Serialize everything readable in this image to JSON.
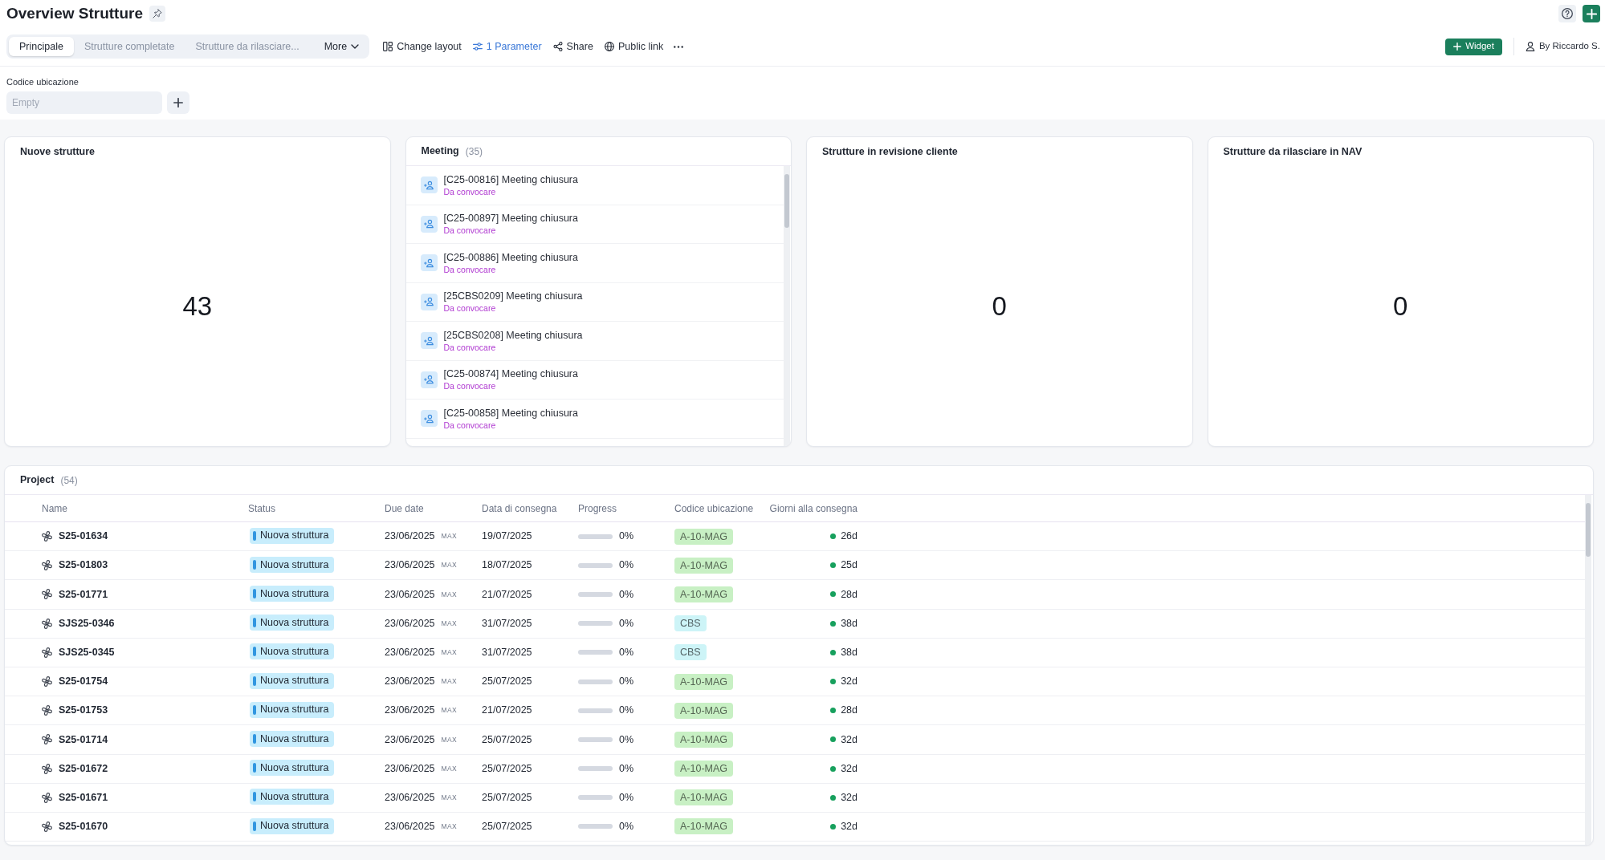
{
  "page": {
    "title": "Overview Strutture"
  },
  "tabs": [
    {
      "label": "Principale",
      "selected": true
    },
    {
      "label": "Strutture completate",
      "selected": false
    },
    {
      "label": "Strutture da rilasciare...",
      "selected": false
    }
  ],
  "more_tab": {
    "label": "More"
  },
  "toolbar": [
    {
      "kind": "layout",
      "label": "Change layout"
    },
    {
      "kind": "parameter",
      "label": "1 Parameter"
    },
    {
      "kind": "share",
      "label": "Share"
    },
    {
      "kind": "link",
      "label": "Public link"
    }
  ],
  "widget_button": {
    "label": "Widget"
  },
  "owner": {
    "label": "By Riccardo S."
  },
  "parameters": [
    {
      "label": "Codice ubicazione",
      "placeholder": "Empty"
    }
  ],
  "widgets": [
    {
      "kind": "number",
      "title": "Nuove strutture",
      "value": "43"
    },
    {
      "kind": "list",
      "title": "Meeting",
      "count": "(35)",
      "items": [
        {
          "title": "[C25-00816] Meeting chiusura",
          "status": "Da convocare"
        },
        {
          "title": "[C25-00897] Meeting chiusura",
          "status": "Da convocare"
        },
        {
          "title": "[C25-00886] Meeting chiusura",
          "status": "Da convocare"
        },
        {
          "title": "[25CBS0209] Meeting chiusura",
          "status": "Da convocare"
        },
        {
          "title": "[25CBS0208] Meeting chiusura",
          "status": "Da convocare"
        },
        {
          "title": "[C25-00874] Meeting chiusura",
          "status": "Da convocare"
        },
        {
          "title": "[C25-00858] Meeting chiusura",
          "status": "Da convocare"
        }
      ]
    },
    {
      "kind": "number",
      "title": "Strutture in revisione cliente",
      "value": "0"
    },
    {
      "kind": "number",
      "title": "Strutture da rilasciare in NAV",
      "value": "0"
    }
  ],
  "project": {
    "title": "Project",
    "count": "(54)",
    "columns": [
      "Name",
      "Status",
      "Due date",
      "Data di consegna",
      "Progress",
      "Codice ubicazione",
      "Giorni alla consegna"
    ],
    "rows": [
      {
        "name": "S25-01634",
        "status": "Nuova struttura",
        "due_date": "23/06/2025",
        "due_limit": "MAX",
        "delivery_date": "19/07/2025",
        "progress": {
          "level": 0,
          "reading": "0%"
        },
        "location": {
          "label": "A-10-MAG",
          "color": "#c8f0c4"
        },
        "days": "26d"
      },
      {
        "name": "S25-01803",
        "status": "Nuova struttura",
        "due_date": "23/06/2025",
        "due_limit": "MAX",
        "delivery_date": "18/07/2025",
        "progress": {
          "level": 0,
          "reading": "0%"
        },
        "location": {
          "label": "A-10-MAG",
          "color": "#c8f0c4"
        },
        "days": "25d"
      },
      {
        "name": "S25-01771",
        "status": "Nuova struttura",
        "due_date": "23/06/2025",
        "due_limit": "MAX",
        "delivery_date": "21/07/2025",
        "progress": {
          "level": 0,
          "reading": "0%"
        },
        "location": {
          "label": "A-10-MAG",
          "color": "#c8f0c4"
        },
        "days": "28d"
      },
      {
        "name": "SJS25-0346",
        "status": "Nuova struttura",
        "due_date": "23/06/2025",
        "due_limit": "MAX",
        "delivery_date": "31/07/2025",
        "progress": {
          "level": 0,
          "reading": "0%"
        },
        "location": {
          "label": "CBS",
          "color": "#cdf4f7"
        },
        "days": "38d"
      },
      {
        "name": "SJS25-0345",
        "status": "Nuova struttura",
        "due_date": "23/06/2025",
        "due_limit": "MAX",
        "delivery_date": "31/07/2025",
        "progress": {
          "level": 0,
          "reading": "0%"
        },
        "location": {
          "label": "CBS",
          "color": "#cdf4f7"
        },
        "days": "38d"
      },
      {
        "name": "S25-01754",
        "status": "Nuova struttura",
        "due_date": "23/06/2025",
        "due_limit": "MAX",
        "delivery_date": "25/07/2025",
        "progress": {
          "level": 0,
          "reading": "0%"
        },
        "location": {
          "label": "A-10-MAG",
          "color": "#c8f0c4"
        },
        "days": "32d"
      },
      {
        "name": "S25-01753",
        "status": "Nuova struttura",
        "due_date": "23/06/2025",
        "due_limit": "MAX",
        "delivery_date": "21/07/2025",
        "progress": {
          "level": 0,
          "reading": "0%"
        },
        "location": {
          "label": "A-10-MAG",
          "color": "#c8f0c4"
        },
        "days": "28d"
      },
      {
        "name": "S25-01714",
        "status": "Nuova struttura",
        "due_date": "23/06/2025",
        "due_limit": "MAX",
        "delivery_date": "25/07/2025",
        "progress": {
          "level": 0,
          "reading": "0%"
        },
        "location": {
          "label": "A-10-MAG",
          "color": "#c8f0c4"
        },
        "days": "32d"
      },
      {
        "name": "S25-01672",
        "status": "Nuova struttura",
        "due_date": "23/06/2025",
        "due_limit": "MAX",
        "delivery_date": "25/07/2025",
        "progress": {
          "level": 0,
          "reading": "0%"
        },
        "location": {
          "label": "A-10-MAG",
          "color": "#c8f0c4"
        },
        "days": "32d"
      },
      {
        "name": "S25-01671",
        "status": "Nuova struttura",
        "due_date": "23/06/2025",
        "due_limit": "MAX",
        "delivery_date": "25/07/2025",
        "progress": {
          "level": 0,
          "reading": "0%"
        },
        "location": {
          "label": "A-10-MAG",
          "color": "#c8f0c4"
        },
        "days": "32d"
      },
      {
        "name": "S25-01670",
        "status": "Nuova struttura",
        "due_date": "23/06/2025",
        "due_limit": "MAX",
        "delivery_date": "25/07/2025",
        "progress": {
          "level": 0,
          "reading": "0%"
        },
        "location": {
          "label": "A-10-MAG",
          "color": "#c8f0c4"
        },
        "days": "32d"
      }
    ]
  }
}
